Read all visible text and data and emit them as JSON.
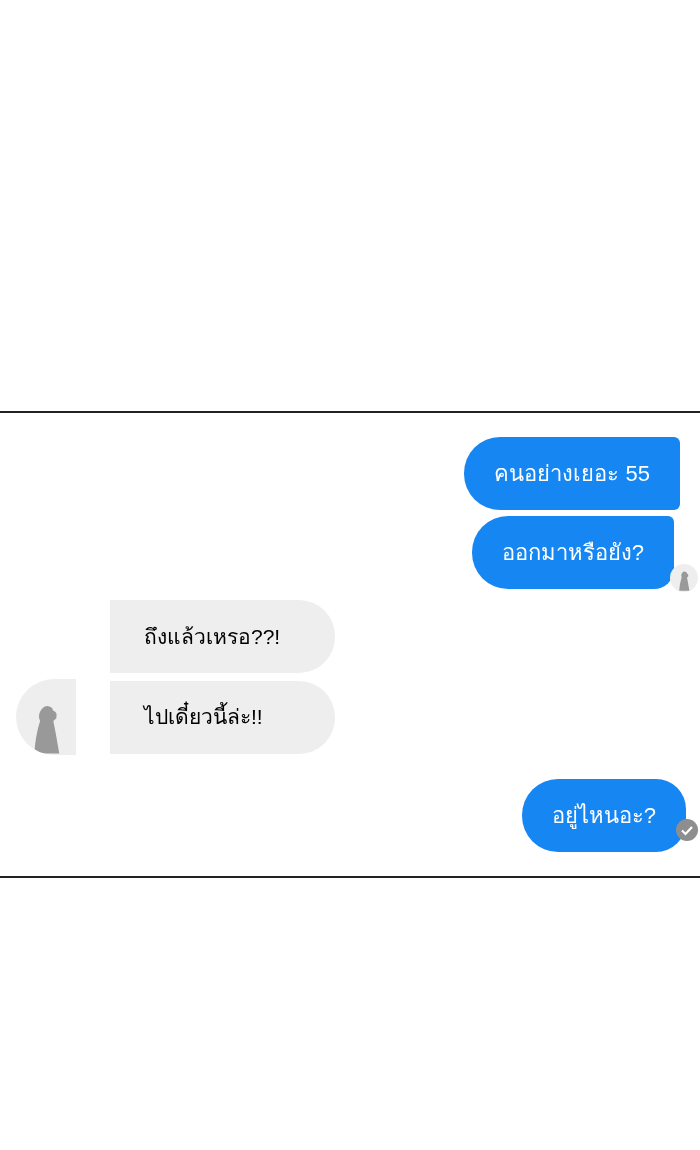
{
  "messages": [
    {
      "kind": "outgoing",
      "text": "คนอย่างเยอะ 55",
      "seen": false,
      "delivered": false
    },
    {
      "kind": "outgoing",
      "text": "ออกมาหรือยัง?",
      "seen": true,
      "delivered": false
    },
    {
      "kind": "incoming",
      "text": "ถึงแล้วเหรอ??!",
      "seen": false,
      "delivered": false
    },
    {
      "kind": "incoming",
      "text": "ไปเดี๋ยวนี้ล่ะ!!",
      "seen": false,
      "delivered": false
    },
    {
      "kind": "outgoing",
      "text": "อยู่ไหนอะ?",
      "seen": false,
      "delivered": true
    }
  ]
}
